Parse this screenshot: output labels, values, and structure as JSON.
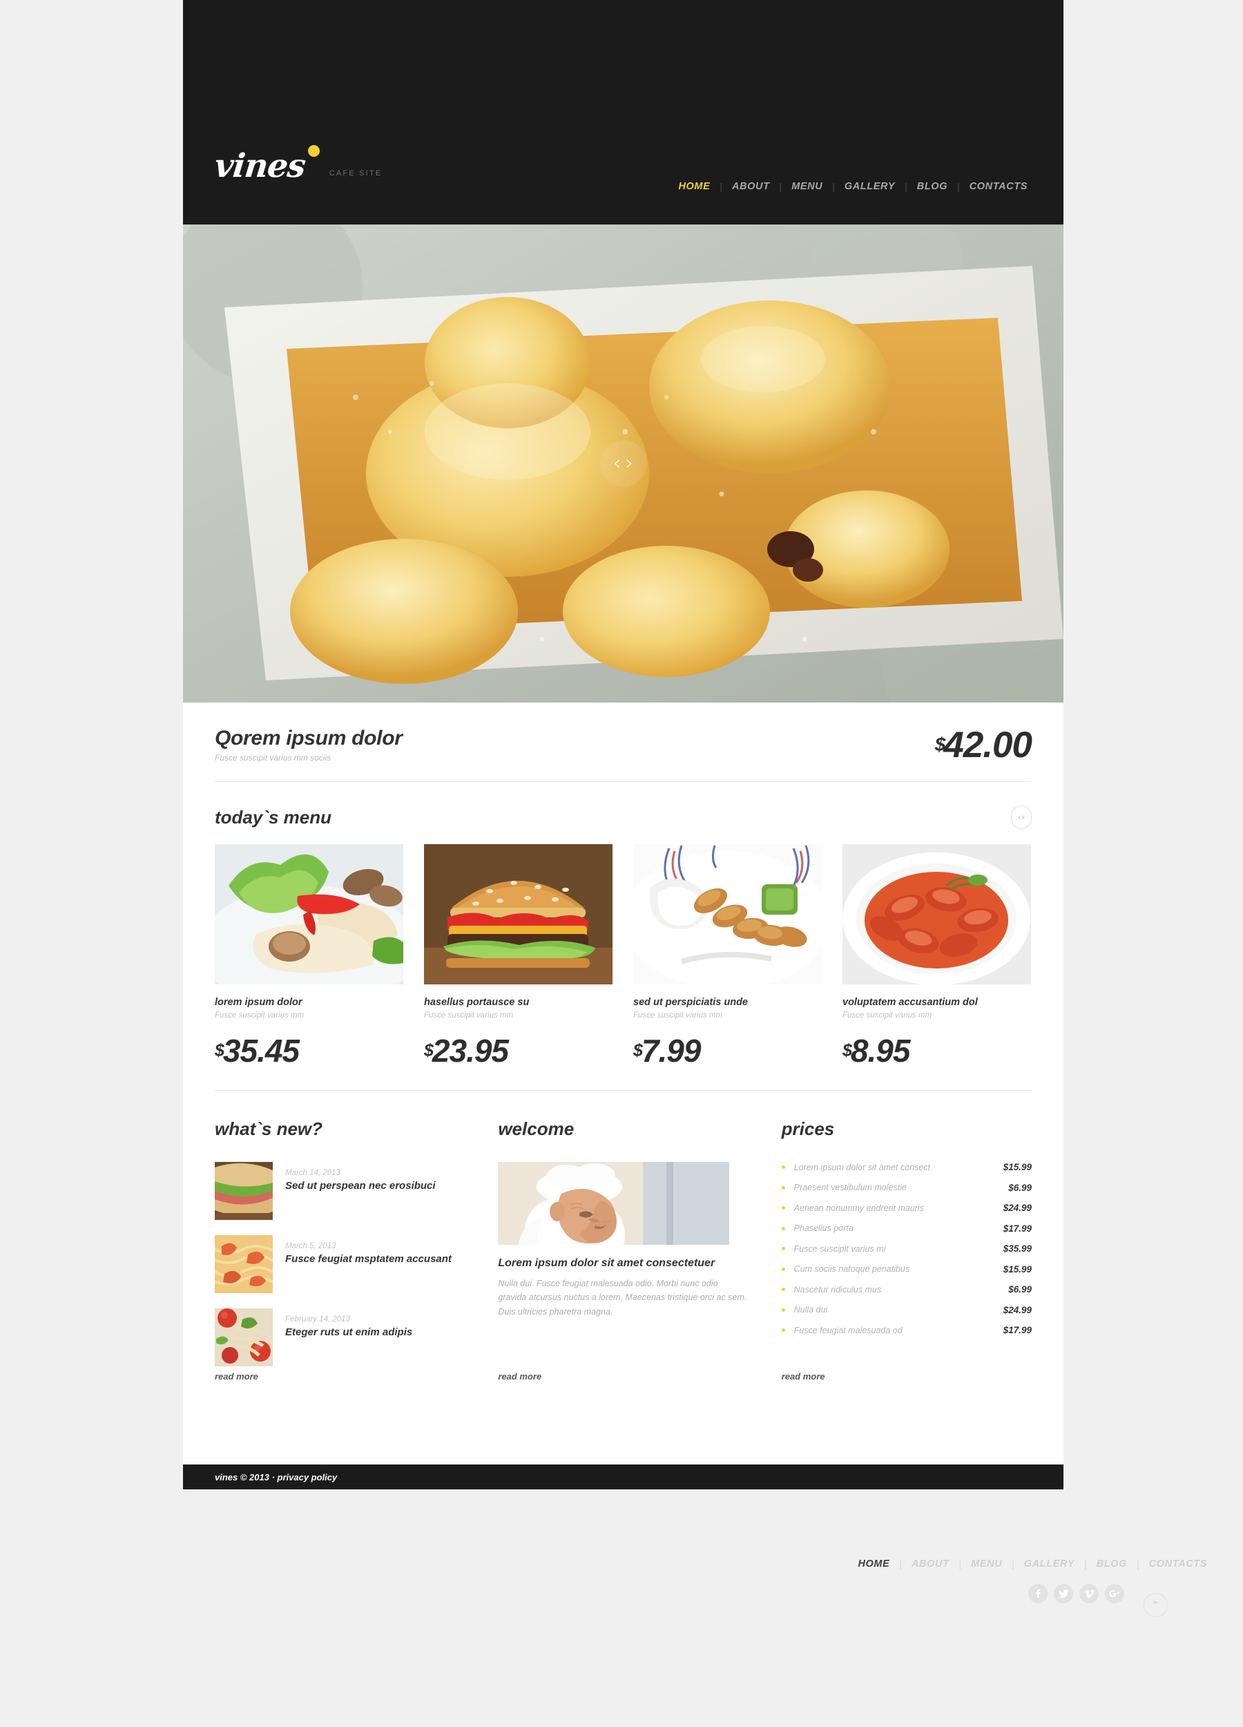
{
  "site": {
    "logo_text": "vines",
    "logo_tagline": "CAFE SITE",
    "accent_color": "#f4cf2e",
    "dark_color": "#1b1b1b"
  },
  "nav": {
    "items": [
      "HOME",
      "ABOUT",
      "MENU",
      "GALLERY",
      "BLOG",
      "CONTACTS"
    ],
    "separator": "|",
    "active": "HOME"
  },
  "hero": {
    "prev_icon": "‹",
    "next_icon": "›",
    "image_alt": "baked pear tart"
  },
  "feature": {
    "title": "Qorem ipsum dolor",
    "subtitle": "Fusce suscipit varius mm sociis",
    "currency": "$",
    "price": "42.00"
  },
  "todays_menu": {
    "title": "today`s menu",
    "pager_prev": "‹",
    "pager_next": "›",
    "items": [
      {
        "name": "lorem ipsum dolor",
        "sub": "Fusce suscipit varius mm",
        "currency": "$",
        "price": "35.45"
      },
      {
        "name": "hasellus portausce su",
        "sub": "Fusce suscipit varius mm",
        "currency": "$",
        "price": "23.95"
      },
      {
        "name": "sed ut perspiciatis unde",
        "sub": "Fusce suscipit varius mm",
        "currency": "$",
        "price": "7.99"
      },
      {
        "name": "voluptatem accusantium dol",
        "sub": "Fusce suscipit varius mm",
        "currency": "$",
        "price": "8.95"
      }
    ]
  },
  "whats_new": {
    "title": "what`s new?",
    "read_more": "read more",
    "posts": [
      {
        "date": "March 14, 2013",
        "title": "Sed ut perspean nec erosibuci"
      },
      {
        "date": "March 5, 2013",
        "title": "Fusce feugiat msptatem accusant"
      },
      {
        "date": "February 14, 2013",
        "title": "Eteger ruts ut enim adipis"
      }
    ]
  },
  "welcome": {
    "title": "welcome",
    "heading": "Lorem ipsum dolor sit amet consectetuer",
    "text": "Nulla dui. Fusce feugiat malesuada odio. Morbi nunc odio gravida atcursus nuctus a lorem. Maecenas tristique orci ac sem. Duis ultricies pharetra magna.",
    "read_more": "read more"
  },
  "prices": {
    "title": "prices",
    "read_more": "read more",
    "rows": [
      {
        "label": "Lorem ipsum dolor sit amet consect",
        "value": "$15.99"
      },
      {
        "label": "Praesent vestibulum molestie",
        "value": "$6.99"
      },
      {
        "label": "Aenean nonummy endrerit mauris",
        "value": "$24.99"
      },
      {
        "label": "Phasellus porta",
        "value": "$17.99"
      },
      {
        "label": "Fusce suscipit varius mi",
        "value": "$35.99"
      },
      {
        "label": "Cum sociis natoque penatibus",
        "value": "$15.99"
      },
      {
        "label": "Nascetur ridiculus mus",
        "value": "$6.99"
      },
      {
        "label": "Nulla dui",
        "value": "$24.99"
      },
      {
        "label": "Fusce feugiat malesuada od",
        "value": "$17.99"
      }
    ]
  },
  "footer": {
    "copyright": "vines © 2013 · privacy policy",
    "nav": [
      "HOME",
      "ABOUT",
      "MENU",
      "GALLERY",
      "BLOG",
      "CONTACTS"
    ],
    "nav_active": "HOME",
    "separator": "|",
    "socials": [
      "facebook",
      "twitter",
      "vimeo",
      "google-plus"
    ],
    "to_top_icon": "⌃"
  }
}
